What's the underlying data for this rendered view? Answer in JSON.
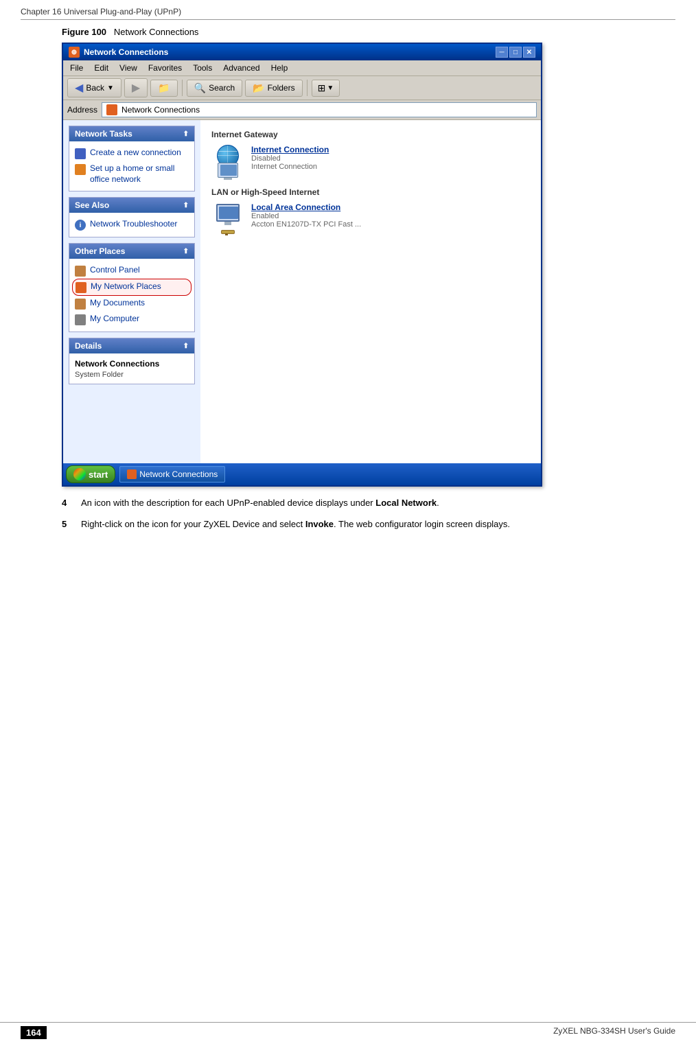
{
  "header": {
    "chapter": "Chapter 16 Universal Plug-and-Play (UPnP)",
    "footer_left": "164",
    "footer_right": "ZyXEL NBG-334SH User's Guide"
  },
  "figure": {
    "label": "Figure 100",
    "title": "Network Connections"
  },
  "window": {
    "title": "Network Connections",
    "menubar": [
      "File",
      "Edit",
      "View",
      "Favorites",
      "Tools",
      "Advanced",
      "Help"
    ],
    "toolbar": {
      "back": "Back",
      "search": "Search",
      "folders": "Folders"
    },
    "address": {
      "label": "Address",
      "value": "Network Connections"
    }
  },
  "left_panel": {
    "sections": [
      {
        "id": "network-tasks",
        "header": "Network Tasks",
        "items": [
          {
            "icon": "blue",
            "text": "Create a new connection"
          },
          {
            "icon": "orange",
            "text": "Set up a home or small office network"
          }
        ]
      },
      {
        "id": "see-also",
        "header": "See Also",
        "items": [
          {
            "icon": "info",
            "text": "Network Troubleshooter"
          }
        ]
      },
      {
        "id": "other-places",
        "header": "Other Places",
        "items": [
          {
            "icon": "folder",
            "text": "Control Panel"
          },
          {
            "icon": "network",
            "text": "My Network Places",
            "highlighted": true
          },
          {
            "icon": "docs",
            "text": "My Documents"
          },
          {
            "icon": "comp",
            "text": "My Computer"
          }
        ]
      },
      {
        "id": "details",
        "header": "Details",
        "content_title": "Network Connections",
        "content_sub": "System Folder"
      }
    ]
  },
  "right_panel": {
    "sections": [
      {
        "label": "Internet Gateway",
        "items": [
          {
            "name": "Internet Connection",
            "status": "Disabled",
            "desc": "Internet Connection"
          }
        ]
      },
      {
        "label": "LAN or High-Speed Internet",
        "items": [
          {
            "name": "Local Area Connection",
            "status": "Enabled",
            "desc": "Accton EN1207D-TX PCI Fast ..."
          }
        ]
      }
    ]
  },
  "taskbar": {
    "start": "start",
    "active_window": "Network Connections"
  },
  "steps": [
    {
      "num": "4",
      "text": "An icon with the description for each UPnP-enabled device displays under ",
      "bold_text": "Local Network",
      "text2": "."
    },
    {
      "num": "5",
      "text": "Right-click on the icon for your ZyXEL Device and select ",
      "bold_text": "Invoke",
      "text2": ". The web configurator login screen displays."
    }
  ]
}
